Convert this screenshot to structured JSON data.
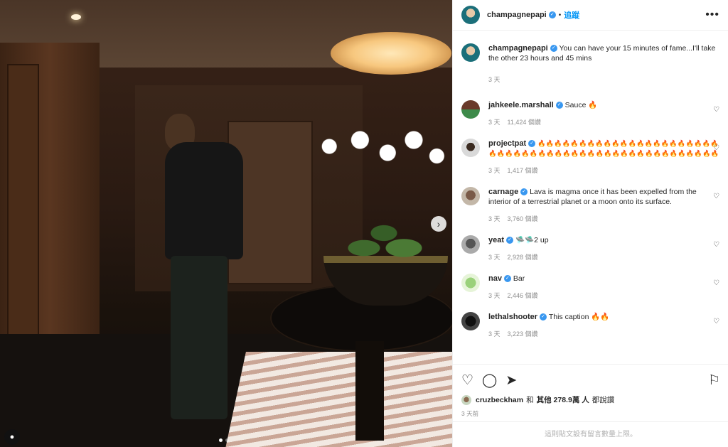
{
  "post": {
    "author": "champagnepapi",
    "follow_label": "追蹤",
    "separator": "•",
    "more_label": "•••",
    "caption": "You can have your 15 minutes of fame...I'll take the other 23 hours and 45 mins",
    "caption_age": "3 天"
  },
  "comments": [
    {
      "user": "jahkeele.marshall",
      "text": "Sauce 🔥",
      "age": "3 天",
      "likes": "11,424 個讚"
    },
    {
      "user": "projectpat",
      "text": "🔥🔥🔥🔥🔥🔥🔥🔥🔥🔥🔥🔥🔥🔥🔥🔥🔥🔥🔥🔥🔥🔥🔥🔥🔥🔥🔥🔥🔥🔥🔥🔥🔥🔥🔥🔥🔥🔥🔥🔥🔥🔥🔥🔥🔥🔥🔥🔥🔥🔥",
      "age": "3 天",
      "likes": "1,417 個讚"
    },
    {
      "user": "carnage",
      "text": "Lava is magma once it has been expelled from the interior of a terrestrial planet or a moon onto its surface.",
      "age": "3 天",
      "likes": "3,760 個讚"
    },
    {
      "user": "yeat",
      "text": "🛸🛸2 up",
      "age": "3 天",
      "likes": "2,928 個讚"
    },
    {
      "user": "nav",
      "text": "Bar",
      "age": "3 天",
      "likes": "2,446 個讚"
    },
    {
      "user": "lethalshooter",
      "text": "This caption 🔥🔥",
      "age": "3 天",
      "likes": "3,223 個讚"
    }
  ],
  "likes_summary": {
    "user": "cruzbeckham",
    "and": "和",
    "rest": "其他 278.9萬 人",
    "suffix": "都說讚"
  },
  "posted_ago": "3 天前",
  "comments_limited": "這則貼文設有留言數量上限。",
  "icons": {
    "next": "chevron-right-icon",
    "heart": "heart-icon",
    "comment": "comment-icon",
    "share": "share-icon",
    "save": "bookmark-icon",
    "tag": "user-tag-icon"
  },
  "colors": {
    "accent": "#0095f6",
    "verified": "#3897f0",
    "muted": "#8e8e8e"
  }
}
